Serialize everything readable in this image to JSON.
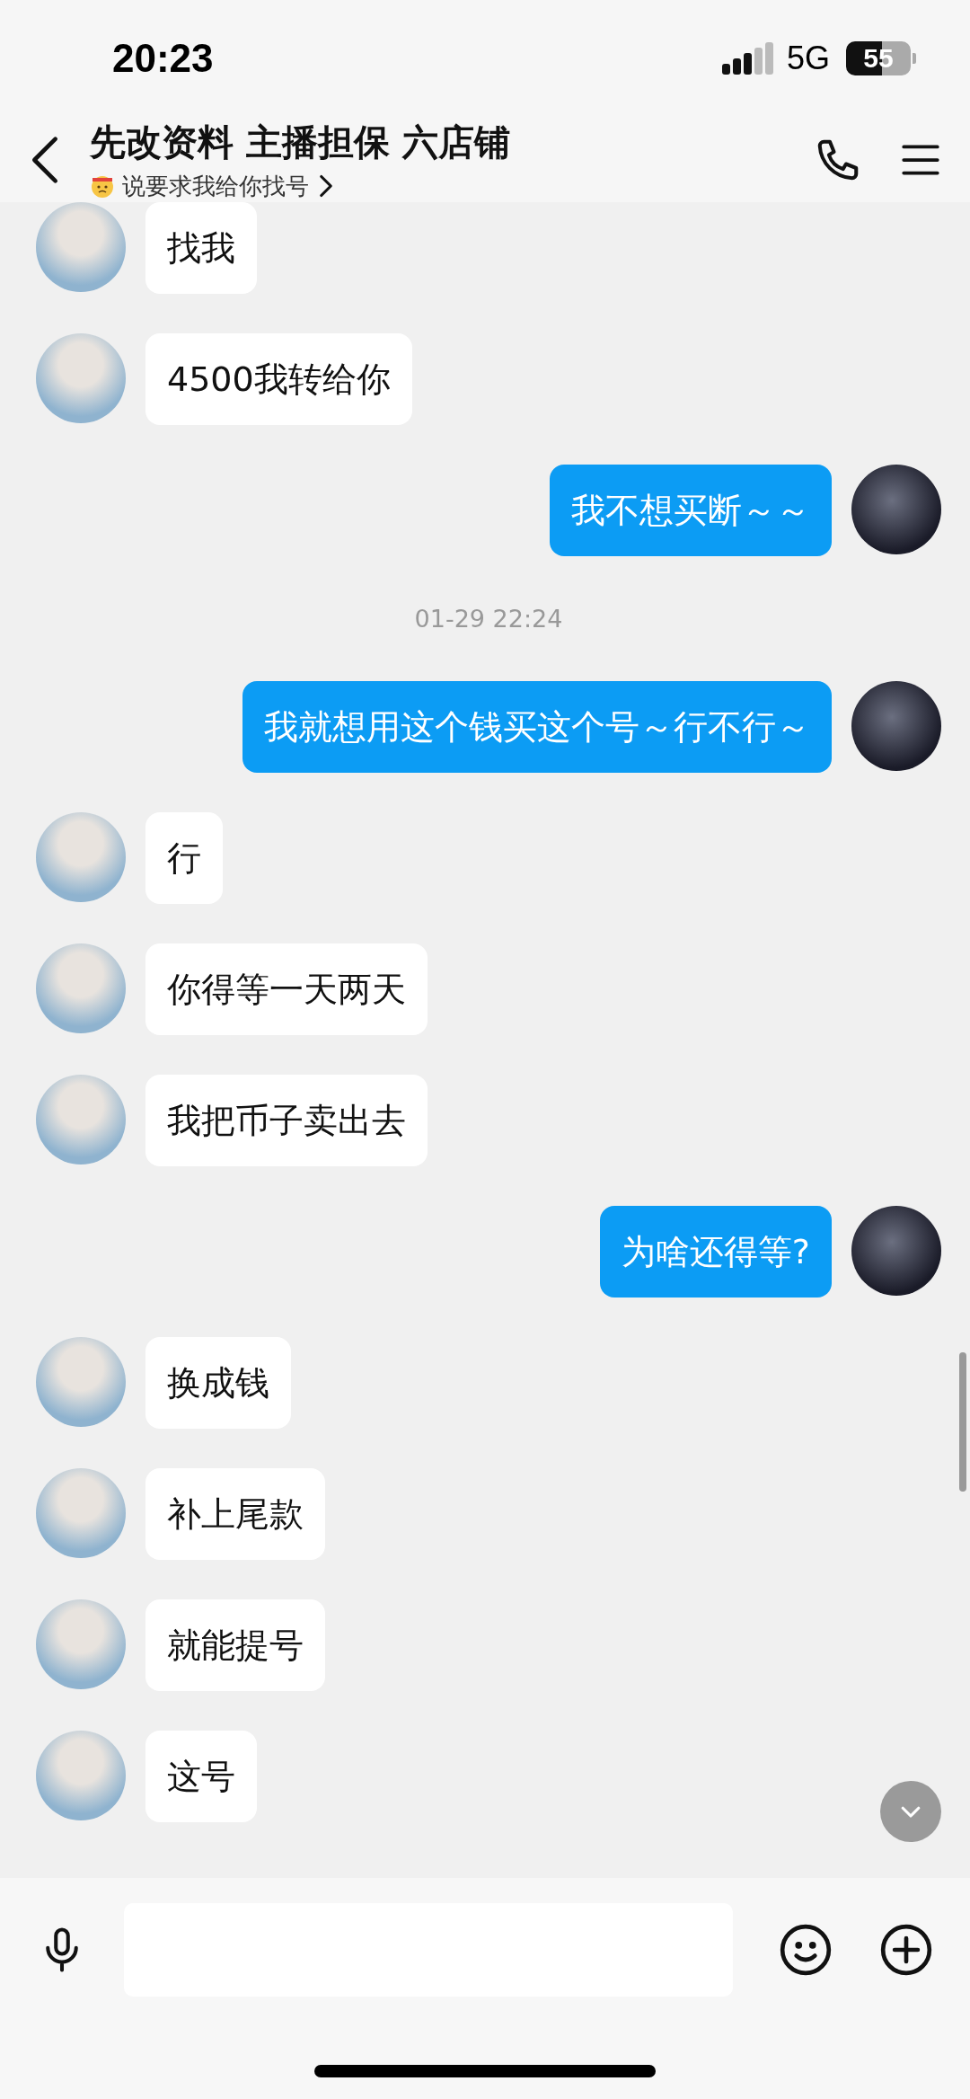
{
  "status_bar": {
    "time": "20:23",
    "network": "5G",
    "battery": "55"
  },
  "header": {
    "title": "先改资料 主播担保 六店铺",
    "subtitle": "说要求我给你找号"
  },
  "messages": [
    {
      "kind": "received",
      "text": "找我"
    },
    {
      "kind": "received",
      "text": "4500我转给你"
    },
    {
      "kind": "sent",
      "text": "我不想买断～～"
    },
    {
      "kind": "time",
      "text": "01-29 22:24"
    },
    {
      "kind": "sent",
      "text": "我就想用这个钱买这个号～行不行～"
    },
    {
      "kind": "received",
      "text": "行"
    },
    {
      "kind": "received",
      "text": "你得等一天两天"
    },
    {
      "kind": "received",
      "text": "我把币子卖出去"
    },
    {
      "kind": "sent",
      "text": "为啥还得等?"
    },
    {
      "kind": "received",
      "text": "换成钱"
    },
    {
      "kind": "received",
      "text": "补上尾款"
    },
    {
      "kind": "received",
      "text": "就能提号"
    },
    {
      "kind": "received",
      "text": "这号"
    }
  ]
}
